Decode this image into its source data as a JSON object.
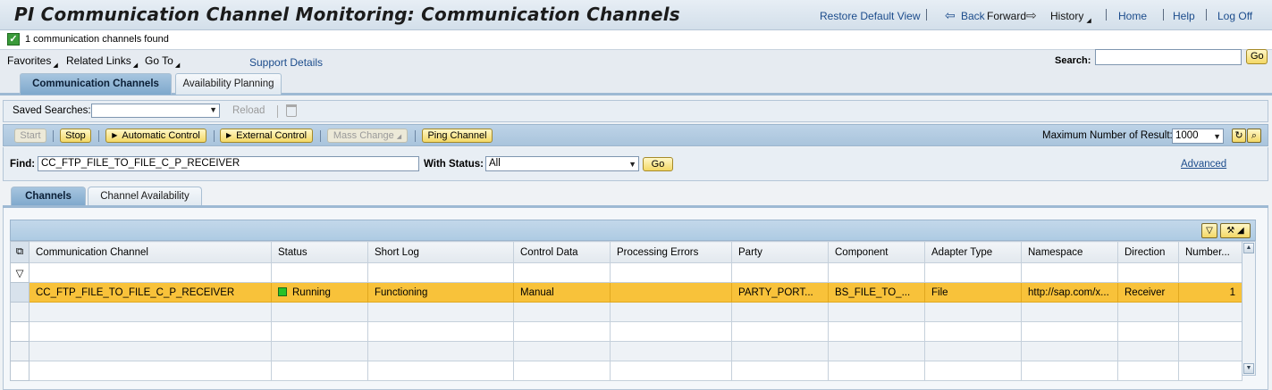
{
  "header": {
    "title": "PI Communication Channel Monitoring: Communication Channels",
    "links": {
      "restore": "Restore Default View",
      "back": "Back",
      "forward": "Forward",
      "history": "History",
      "home": "Home",
      "help": "Help",
      "logoff": "Log Off"
    }
  },
  "message": {
    "text": "1 communication channels found",
    "type": "success"
  },
  "menu": {
    "favorites": "Favorites",
    "related_links": "Related Links",
    "go_to": "Go To",
    "support_details": "Support Details",
    "search_label": "Search:",
    "search_value": "",
    "search_go": "Go"
  },
  "tabs": [
    {
      "label": "Communication Channels",
      "active": true
    },
    {
      "label": "Availability Planning",
      "active": false
    }
  ],
  "saved_searches": {
    "label": "Saved Searches:",
    "selected": "",
    "reload": "Reload"
  },
  "toolbar": {
    "start": "Start",
    "stop": "Stop",
    "automatic_control": "Automatic Control",
    "external_control": "External Control",
    "mass_change": "Mass Change",
    "ping_channel": "Ping Channel",
    "max_results_label": "Maximum Number of Result:",
    "max_results_value": "1000"
  },
  "find": {
    "label": "Find:",
    "value": "CC_FTP_FILE_TO_FILE_C_P_RECEIVER",
    "status_label": "With Status:",
    "status_value": "All",
    "go": "Go",
    "advanced": "Advanced"
  },
  "inner_tabs": [
    {
      "label": "Channels",
      "active": true
    },
    {
      "label": "Channel Availability",
      "active": false
    }
  ],
  "table": {
    "columns": [
      "Communication Channel",
      "Status",
      "Short Log",
      "Control Data",
      "Processing Errors",
      "Party",
      "Component",
      "Adapter Type",
      "Namespace",
      "Direction",
      "Number..."
    ],
    "rows": [
      {
        "channel": "CC_FTP_FILE_TO_FILE_C_P_RECEIVER",
        "status": "Running",
        "short_log": "Functioning",
        "control_data": "Manual",
        "processing_errors": "",
        "party": "PARTY_PORT...",
        "component": "BS_FILE_TO_...",
        "adapter_type": "File",
        "namespace": "http://sap.com/x...",
        "direction": "Receiver",
        "number": "1"
      }
    ]
  },
  "colors": {
    "highlight_row": "#f8c23a",
    "status_running": "#28c228",
    "link": "#1c4c8c"
  }
}
